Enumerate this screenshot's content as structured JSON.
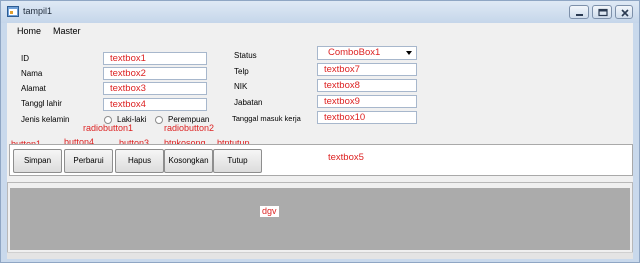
{
  "window": {
    "title": "tampil1"
  },
  "menu": {
    "items": [
      "Home",
      "Master"
    ]
  },
  "left_form": {
    "fields": [
      {
        "label": "ID",
        "value": "textbox1"
      },
      {
        "label": "Nama",
        "value": "textbox2"
      },
      {
        "label": "Alamat",
        "value": "textbox3"
      },
      {
        "label": "Tanggl lahir",
        "value": "textbox4"
      }
    ],
    "gender": {
      "label": "Jenis kelamin",
      "options": [
        "Laki-laki",
        "Perempuan"
      ],
      "control_names": [
        "radiobutton1",
        "radiobutton2"
      ]
    }
  },
  "right_form": {
    "status": {
      "label": "Status",
      "value": "ComboBox1"
    },
    "fields": [
      {
        "label": "Telp",
        "value": "textbox7"
      },
      {
        "label": "NIK",
        "value": "textbox8"
      },
      {
        "label": "Jabatan",
        "value": "textbox9"
      },
      {
        "label": "Tanggal masuk kerja",
        "value": "textbox10"
      }
    ]
  },
  "toolbar": {
    "buttons": [
      {
        "label": "Simpan",
        "control_name": "button1"
      },
      {
        "label": "Perbarui",
        "control_name": "button4"
      },
      {
        "label": "Hapus",
        "control_name": "button3"
      },
      {
        "label": "Kosongkan",
        "control_name": "btnkosong"
      },
      {
        "label": "Tutup",
        "control_name": "btntutup"
      }
    ],
    "textbox": "textbox5"
  },
  "grid": {
    "name": "dgv"
  }
}
